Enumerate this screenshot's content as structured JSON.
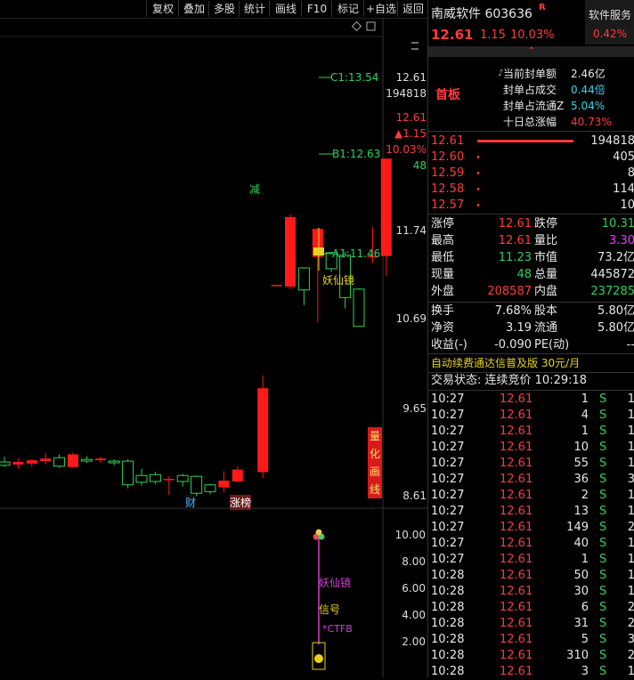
{
  "toolbar": {
    "buttons": [
      "复权",
      "叠加",
      "多股",
      "统计",
      "画线",
      "F10",
      "标记",
      "+自选",
      "返回"
    ]
  },
  "chart": {
    "price_axis": [
      "12.61",
      "11.74",
      "10.69",
      "9.65",
      "8.61"
    ],
    "volume_axis_top": "194818",
    "price_info": {
      "price": "12.61",
      "change": "▲1.15",
      "pct": "10.03%",
      "vol": "48"
    },
    "labels": {
      "c1": "C1:13.54",
      "b1": "B1:12.63",
      "a1": "A1:11.46",
      "jian": "减",
      "yaoxianjing": "妖仙镜",
      "cai": "财",
      "zhangbang": "涨榜",
      "lianghua": [
        "量",
        "化",
        "画",
        "线"
      ]
    },
    "indicator": {
      "axis": [
        "10.00",
        "8.00",
        "6.00",
        "4.00",
        "2.00"
      ],
      "yaoxianjing": "妖仙镜",
      "xinhao": "信号",
      "ctfb": "*CTFB"
    },
    "colors": {
      "up": "#ff1a1a",
      "down": "#2fd158",
      "label_yellow": "#e8d21d",
      "magenta": "#d63ad6"
    },
    "candles": [
      {
        "o": 9.03,
        "h": 9.09,
        "l": 8.97,
        "c": 8.99
      },
      {
        "o": 9.0,
        "h": 9.07,
        "l": 8.95,
        "c": 9.03
      },
      {
        "o": 9.01,
        "h": 9.06,
        "l": 8.97,
        "c": 9.05
      },
      {
        "o": 9.04,
        "h": 9.13,
        "l": 9.0,
        "c": 9.07
      },
      {
        "o": 9.08,
        "h": 9.12,
        "l": 8.96,
        "c": 8.98
      },
      {
        "o": 8.97,
        "h": 9.14,
        "l": 8.96,
        "c": 9.12
      },
      {
        "o": 9.06,
        "h": 9.1,
        "l": 9.02,
        "c": 9.04
      },
      {
        "o": 9.05,
        "h": 9.09,
        "l": 9.02,
        "c": 9.07
      },
      {
        "o": 9.04,
        "h": 9.06,
        "l": 8.99,
        "c": 9.02
      },
      {
        "o": 9.04,
        "h": 9.06,
        "l": 8.72,
        "c": 8.76
      },
      {
        "o": 8.87,
        "h": 8.95,
        "l": 8.75,
        "c": 8.79
      },
      {
        "o": 8.88,
        "h": 8.91,
        "l": 8.77,
        "c": 8.8
      },
      {
        "o": 8.82,
        "h": 8.86,
        "l": 8.64,
        "c": 8.83
      },
      {
        "o": 8.87,
        "h": 8.89,
        "l": 8.74,
        "c": 8.8
      },
      {
        "o": 8.86,
        "h": 8.87,
        "l": 8.63,
        "c": 8.66
      },
      {
        "o": 8.76,
        "h": 8.77,
        "l": 8.65,
        "c": 8.68
      },
      {
        "o": 8.73,
        "h": 8.92,
        "l": 8.67,
        "c": 8.81
      },
      {
        "o": 8.8,
        "h": 8.98,
        "l": 8.79,
        "c": 8.94
      },
      {
        "o": 8.91,
        "h": 10.05,
        "l": 8.84,
        "c": 9.9
      },
      {
        "o": 11.12,
        "h": 11.12,
        "l": 11.12,
        "c": 11.12
      },
      {
        "o": 11.1,
        "h": 11.95,
        "l": 11.07,
        "c": 11.92
      },
      {
        "o": 11.32,
        "h": 11.33,
        "l": 10.88,
        "c": 11.06
      },
      {
        "o": 11.45,
        "h": 11.79,
        "l": 10.68,
        "c": 11.78
      },
      {
        "o": 11.5,
        "h": 11.51,
        "l": 11.27,
        "c": 11.31
      },
      {
        "o": 11.47,
        "h": 11.51,
        "l": 10.84,
        "c": 10.97
      },
      {
        "o": 11.07,
        "h": 11.08,
        "l": 10.63,
        "c": 10.63
      },
      {
        "o": 11.46,
        "h": 11.8,
        "l": 11.38,
        "c": 11.46
      },
      {
        "o": 11.46,
        "h": 12.61,
        "l": 11.23,
        "c": 12.61
      }
    ]
  },
  "quote": {
    "name": "南威软件",
    "code": "603636",
    "r_badge": "R",
    "service_label": "软件服务",
    "service_pct": "0.42%",
    "price": "12.61",
    "change": "1.15",
    "pct": "10.03%",
    "badge": "首板",
    "seal": [
      {
        "label": "当前封单额",
        "value": "2.46亿"
      },
      {
        "label": "封单占成交",
        "value": "0.44倍"
      },
      {
        "label": "封单占流通Z",
        "value": "5.04%"
      },
      {
        "label": "十日总涨幅",
        "value": "40.73%"
      }
    ],
    "book": [
      {
        "price": "12.61",
        "vol": "194818",
        "bar": 1.0
      },
      {
        "price": "12.60",
        "vol": "405",
        "bar": 0.02
      },
      {
        "price": "12.59",
        "vol": "8",
        "bar": 0.02
      },
      {
        "price": "12.58",
        "vol": "114",
        "bar": 0.02
      },
      {
        "price": "12.57",
        "vol": "10",
        "bar": 0.02
      }
    ],
    "stats": [
      {
        "l1": "涨停",
        "v1": "12.61",
        "l2": "跌停",
        "v2": "10.31"
      },
      {
        "l1": "最高",
        "v1": "12.61",
        "l2": "量比",
        "v2": "3.30"
      },
      {
        "l1": "最低",
        "v1": "11.23",
        "l2": "市值",
        "v2": "73.2亿"
      },
      {
        "l1": "现量",
        "v1": "48",
        "l2": "总量",
        "v2": "445872"
      },
      {
        "l1": "外盘",
        "v1": "208587",
        "l2": "内盘",
        "v2": "237285"
      }
    ],
    "stats2": [
      {
        "l1": "换手",
        "v1": "7.68%",
        "l2": "股本",
        "v2": "5.80亿"
      },
      {
        "l1": "净资",
        "v1": "3.19",
        "l2": "流通",
        "v2": "5.80亿"
      },
      {
        "l1": "收益(-)",
        "v1": "-0.090",
        "l2": "PE(动)",
        "v2": "--"
      }
    ],
    "promo": "自动续费通达信普及版 30元/月",
    "trade_status": "交易状态: 连续竞价 10:29:18",
    "ticks": [
      {
        "t": "10:27",
        "p": "12.61",
        "v": "1"
      },
      {
        "t": "10:27",
        "p": "12.61",
        "v": "4"
      },
      {
        "t": "10:27",
        "p": "12.61",
        "v": "1"
      },
      {
        "t": "10:27",
        "p": "12.61",
        "v": "10"
      },
      {
        "t": "10:27",
        "p": "12.61",
        "v": "55"
      },
      {
        "t": "10:27",
        "p": "12.61",
        "v": "36"
      },
      {
        "t": "10:27",
        "p": "12.61",
        "v": "2"
      },
      {
        "t": "10:27",
        "p": "12.61",
        "v": "13"
      },
      {
        "t": "10:27",
        "p": "12.61",
        "v": "149"
      },
      {
        "t": "10:27",
        "p": "12.61",
        "v": "40"
      },
      {
        "t": "10:27",
        "p": "12.61",
        "v": "1"
      },
      {
        "t": "10:28",
        "p": "12.61",
        "v": "50"
      },
      {
        "t": "10:28",
        "p": "12.61",
        "v": "30"
      },
      {
        "t": "10:28",
        "p": "12.61",
        "v": "6"
      },
      {
        "t": "10:28",
        "p": "12.61",
        "v": "31"
      },
      {
        "t": "10:28",
        "p": "12.61",
        "v": "5"
      },
      {
        "t": "10:28",
        "p": "12.61",
        "v": "310"
      },
      {
        "t": "10:28",
        "p": "12.61",
        "v": "3"
      }
    ],
    "tick_side": "S",
    "tick_tail": [
      "1",
      "1",
      "1",
      "1",
      "1",
      "3",
      "1",
      "1",
      "2",
      "1",
      "1",
      "1",
      "1",
      "2",
      "2",
      "3",
      "2",
      "1"
    ]
  }
}
